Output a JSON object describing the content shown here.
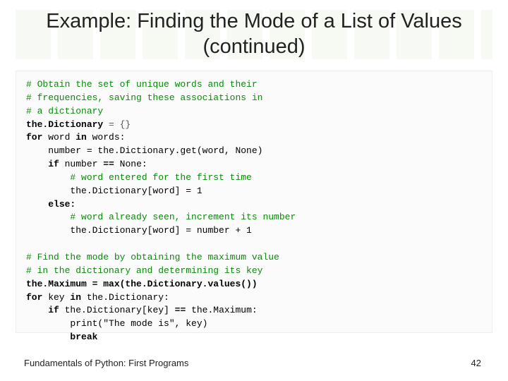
{
  "title": "Example: Finding the Mode of a List of Values (continued)",
  "footer": {
    "left": "Fundamentals of Python: First Programs",
    "page": "42"
  },
  "code": {
    "l01": "# Obtain the set of unique words and their",
    "l02": "# frequencies, saving these associations in",
    "l03": "# a dictionary",
    "l04a": "the.Dictionary ",
    "l04b": "= {}",
    "l05a": "for",
    "l05b": " word ",
    "l05c": "in",
    "l05d": " words:",
    "l06": "    number = the.Dictionary.get(word, None)",
    "l07a": "    ",
    "l07b": "if",
    "l07c": " number ",
    "l07d": "==",
    "l07e": " None:",
    "l08": "        # word entered for the first time",
    "l09": "        the.Dictionary[word] = 1",
    "l10a": "    ",
    "l10b": "else:",
    "l11": "        # word already seen, increment its number",
    "l12": "        the.Dictionary[word] = number + 1",
    "l13": "",
    "l14": "# Find the mode by obtaining the maximum value",
    "l15": "# in the dictionary and determining its key",
    "l16": "the.Maximum = max(the.Dictionary.values())",
    "l17a": "for",
    "l17b": " key ",
    "l17c": "in",
    "l17d": " the.Dictionary:",
    "l18a": "    ",
    "l18b": "if",
    "l18c": " the.Dictionary[key] ",
    "l18d": "==",
    "l18e": " the.Maximum:",
    "l19": "        print(\"The mode is\", key)",
    "l20a": "        ",
    "l20b": "break"
  }
}
